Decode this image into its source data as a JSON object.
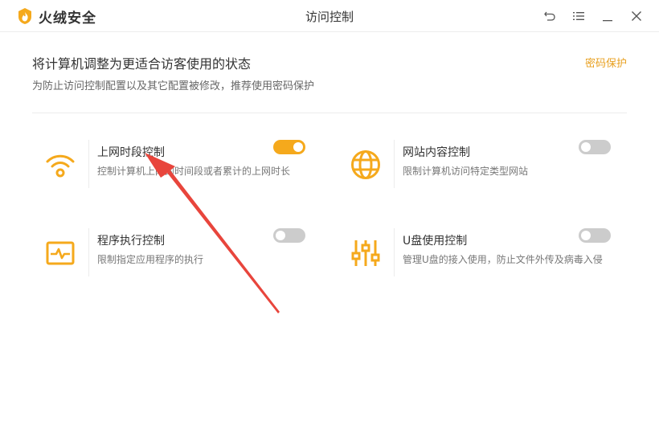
{
  "app": {
    "name": "火绒安全",
    "window_title": "访问控制"
  },
  "window_controls": {
    "back_icon": "undo-arrow-icon",
    "menu_icon": "menu-icon",
    "minimize_icon": "minimize-icon",
    "close_icon": "close-icon"
  },
  "header": {
    "title": "将计算机调整为更适合访客使用的状态",
    "subtitle": "为防止访问控制配置以及其它配置被修改，推荐使用密码保护",
    "password_link": "密码保护"
  },
  "features": [
    {
      "title": "上网时段控制",
      "description": "控制计算机上网的时间段或者累计的上网时长",
      "icon": "wifi-icon",
      "enabled": true
    },
    {
      "title": "网站内容控制",
      "description": "限制计算机访问特定类型网站",
      "icon": "globe-icon",
      "enabled": false
    },
    {
      "title": "程序执行控制",
      "description": "限制指定应用程序的执行",
      "icon": "monitor-pulse-icon",
      "enabled": false
    },
    {
      "title": "U盘使用控制",
      "description": "管理U盘的接入使用，防止文件外传及病毒入侵",
      "icon": "sliders-icon",
      "enabled": false
    }
  ],
  "colors": {
    "accent": "#f5a91c",
    "link": "#e8a020",
    "toggle_off": "#cccccc",
    "annotation": "#e8453c"
  }
}
